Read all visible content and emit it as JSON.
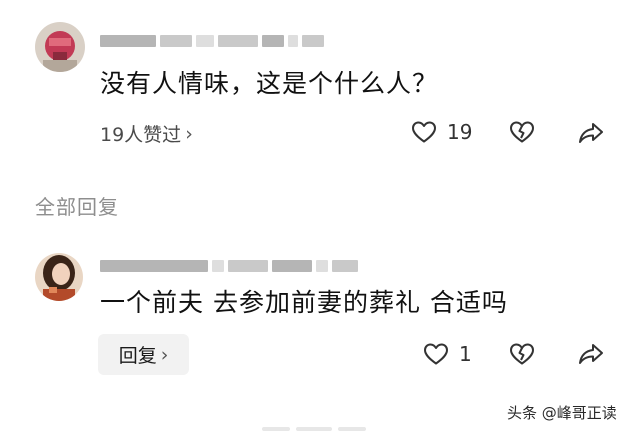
{
  "comment": {
    "text": "没有人情味，这是个什么人？",
    "likes_summary": "19人赞过",
    "like_count": "19",
    "icons": [
      "heart-icon",
      "broken-heart-icon",
      "share-icon"
    ]
  },
  "section": {
    "title": "全部回复"
  },
  "reply": {
    "text": "一个前夫 去参加前妻的葬礼 合适吗",
    "reply_button_label": "回复",
    "like_count": "1",
    "icons": [
      "heart-icon",
      "broken-heart-icon",
      "share-icon"
    ]
  },
  "watermark": {
    "text": "头条 @峰哥正读"
  },
  "colors": {
    "text": "#111111",
    "muted": "#8e8e8e",
    "reply_button_bg": "#f2f2f2",
    "avatar1": "#c23a55",
    "avatar2_bg": "#e9d6c4"
  }
}
